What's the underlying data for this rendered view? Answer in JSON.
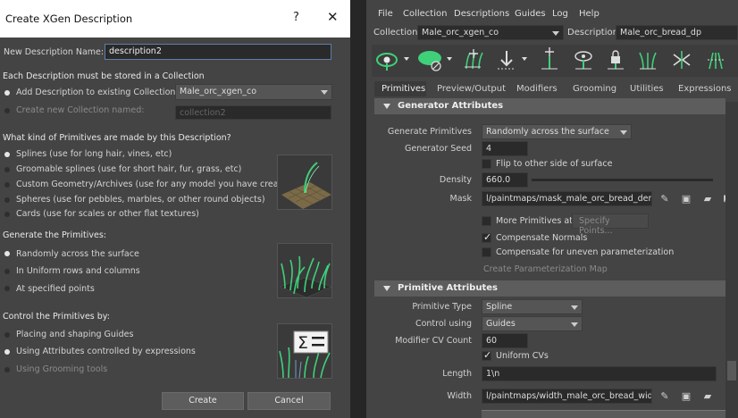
{
  "dialog": {
    "title": "Create XGen Description",
    "help": "?",
    "close": "✕",
    "name_label": "New Description Name:",
    "name_value": "description2",
    "collection_heading": "Each Description must be stored in a Collection",
    "add_existing_label": "Add Description to existing Collection:",
    "existing_collection_value": "Male_orc_xgen_co",
    "create_new_label": "Create new Collection named:",
    "new_collection_placeholder": "collection2",
    "primitives_heading": "What kind of Primitives are made by this Description?",
    "primitive_options": [
      {
        "label": "Splines (use for long hair, vines, etc)",
        "selected": true
      },
      {
        "label": "Groomable splines (use for short hair, fur, grass, etc)",
        "selected": false
      },
      {
        "label": "Custom Geometry/Archives (use for any model you have created)",
        "selected": false
      },
      {
        "label": "Spheres (use for pebbles, marbles, or other round objects)",
        "selected": false
      },
      {
        "label": "Cards (use for scales or other flat textures)",
        "selected": false
      }
    ],
    "generate_heading": "Generate the Primitives:",
    "generate_options": [
      {
        "label": "Randomly across the surface",
        "selected": true
      },
      {
        "label": "In Uniform rows and columns",
        "selected": false
      },
      {
        "label": "At specified points",
        "selected": false
      }
    ],
    "control_heading": "Control the Primitives by:",
    "control_options": [
      {
        "label": "Placing and shaping Guides",
        "selected": false
      },
      {
        "label": "Using Attributes controlled by expressions",
        "selected": true
      },
      {
        "label": "Using Grooming tools",
        "selected": false,
        "disabled": true
      }
    ],
    "create_button": "Create",
    "cancel_button": "Cancel"
  },
  "xgen": {
    "menu": [
      "File",
      "Collection",
      "Descriptions",
      "Guides",
      "Log",
      "Help"
    ],
    "collection_label": "Collection",
    "collection_value": "Male_orc_xgen_co",
    "description_label": "Description",
    "description_value": "Male_orc_bread_dp",
    "tabs": [
      "Primitives",
      "Preview/Output",
      "Modifiers",
      "Grooming",
      "Utilities",
      "Expressions"
    ],
    "generator": {
      "title": "Generator Attributes",
      "generate_primitives_label": "Generate Primitives",
      "generate_primitives_value": "Randomly across the surface",
      "seed_label": "Generator Seed",
      "seed_value": "4",
      "flip_label": "Flip to other side of surface",
      "density_label": "Density",
      "density_value": "660.0",
      "mask_label": "Mask",
      "mask_value": "l/paintmaps/mask_male_orc_bread_density",
      "more_primitives_label": "More Primitives at",
      "specify_points_label": "Specify Points...",
      "compensate_normals_label": "Compensate Normals",
      "compensate_uneven_label": "Compensate for uneven parameterization",
      "create_param_map_label": "Create Parameterization Map"
    },
    "primitive": {
      "title": "Primitive Attributes",
      "type_label": "Primitive Type",
      "type_value": "Spline",
      "control_label": "Control using",
      "control_value": "Guides",
      "modifier_cv_label": "Modifier CV Count",
      "modifier_cv_value": "60",
      "uniform_cvs_label": "Uniform CVs",
      "length_label": "Length",
      "length_value": "1\\n",
      "width_label": "Width",
      "width_value": "l/paintmaps/width_male_orc_bread_width"
    }
  },
  "colors": {
    "panel": "#444444",
    "field": "#2a2a2a",
    "section": "#5d5d5d",
    "accent_green": "#3fd07a"
  }
}
